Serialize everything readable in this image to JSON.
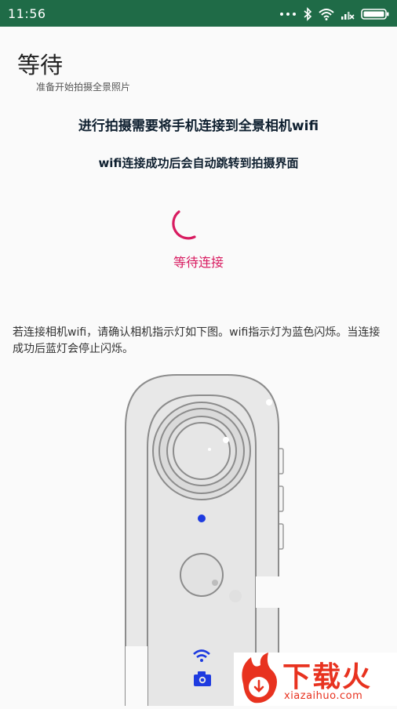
{
  "status_bar": {
    "time": "11:56",
    "icons": [
      "signal-dots-icon",
      "bluetooth-icon",
      "wifi-icon",
      "no-signal-icon",
      "battery-icon"
    ]
  },
  "header": {
    "title": "等待",
    "subtitle": "准备开始拍摄全景照片"
  },
  "main": {
    "instruction_primary": "进行拍摄需要将手机连接到全景相机wifi",
    "instruction_secondary": "wifi连接成功后会自动跳转到拍摄界面",
    "status_label": "等待连接",
    "hint_text": "若连接相机wifi，请确认相机指示灯如下图。wifi指示灯为蓝色闪烁。当连接成功后蓝灯会停止闪烁。"
  },
  "watermark": {
    "logo_text": "下载火",
    "logo_url_text": "xiazaihuo.com"
  },
  "colors": {
    "status_bar": "#1f6b47",
    "accent_pink": "#d81b60",
    "indicator_blue": "#1e3be0",
    "logo_red": "#e8321f"
  }
}
